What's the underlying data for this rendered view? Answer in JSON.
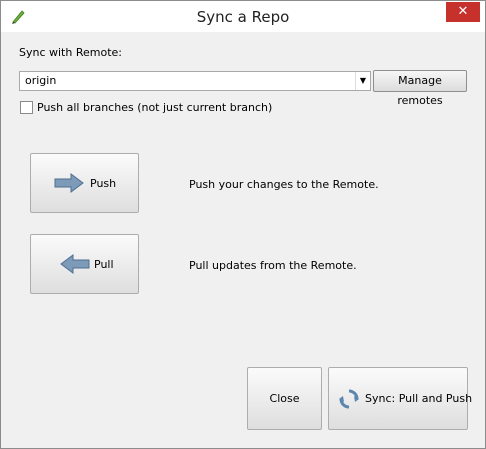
{
  "window": {
    "title": "Sync a Repo",
    "close_glyph": "✕"
  },
  "sync": {
    "label": "Sync with Remote:",
    "remote_value": "origin",
    "manage_label": "Manage remotes"
  },
  "push_all": {
    "label": "Push all branches (not just current branch)",
    "checked": false
  },
  "actions": {
    "push_label": "Push",
    "push_desc": "Push your changes to the Remote.",
    "pull_label": "Pull",
    "pull_desc": "Pull updates from the Remote."
  },
  "footer": {
    "close_label": "Close",
    "sync_label": "Sync: Pull and Push"
  },
  "icons": {
    "app": "pen-icon",
    "push": "arrow-right-icon",
    "pull": "arrow-left-icon",
    "sync": "sync-icon"
  },
  "colors": {
    "close_button": "#c7312c",
    "arrow_fill": "#7d9bb8"
  }
}
